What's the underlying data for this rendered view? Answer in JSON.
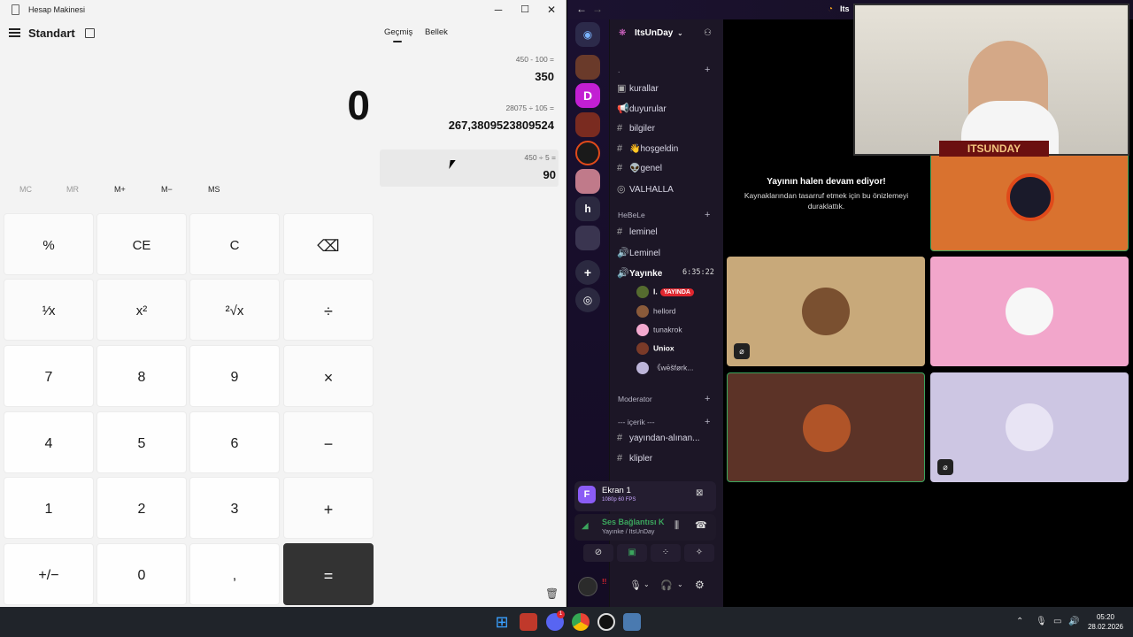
{
  "calculator": {
    "window_title": "Hesap Makinesi",
    "mode_title": "Standart",
    "display_value": "0",
    "tabs": [
      "Geçmiş",
      "Bellek"
    ],
    "memory_buttons": [
      "MC",
      "MR",
      "M+",
      "M−",
      "MS"
    ],
    "keys": [
      "%",
      "CE",
      "C",
      "⌫",
      "¹⁄x",
      "x²",
      "²√x",
      "÷",
      "7",
      "8",
      "9",
      "×",
      "4",
      "5",
      "6",
      "−",
      "1",
      "2",
      "3",
      "+",
      "+/−",
      "0",
      ",",
      "="
    ],
    "history": [
      {
        "expression": "450   -   100 =",
        "result": "350"
      },
      {
        "expression": "28075   ÷   105 =",
        "result": "267,3809523809524"
      },
      {
        "expression": "450   ÷   5 =",
        "result": "90"
      }
    ]
  },
  "discord": {
    "server_name": "ItsUnDay",
    "top_title": "Its",
    "server_icons": [
      "D",
      "h"
    ],
    "categories": [
      ".",
      "HeBeLe",
      "Moderator",
      "--- içerik ---"
    ],
    "channels_a": [
      "kurallar",
      "duyurular",
      "bilgiler",
      "👋hoşgeldin",
      "👽genel",
      "VALHALLA"
    ],
    "channels_b": [
      "leminel",
      "Leminel"
    ],
    "voice_channel": {
      "name": "Yayınke",
      "time": "6:35:22"
    },
    "voice_users": [
      "I.",
      "hellord",
      "tunakrok",
      "Uniox",
      "《wēšførk..."
    ],
    "live_badge": "YAYINDA",
    "channels_c": [
      "yayından-alınan...",
      "klipler"
    ],
    "stream_panel": {
      "title": "Ekran 1",
      "quality": "1080p 60 FPS"
    },
    "voice_panel": {
      "status": "Ses Bağlantısı K",
      "location": "Yayınke / ItsUnDay"
    },
    "user_name": "!!",
    "stream_notice": {
      "title": "Yayının halen devam ediyor!",
      "body": "Kaynaklarından tasarruf etmek için bu önizlemeyi duraklattık."
    },
    "webcam_banner": "ITSUNDAY"
  },
  "taskbar": {
    "time": "05:20",
    "date": "28.02.2026",
    "notification_badge": "1"
  },
  "colors": {
    "calc_bg": "#f3f3f3",
    "equals_key": "#333333",
    "discord_bg": "#121214",
    "tile_tan": "#c8a97a",
    "tile_pink": "#f2a6cb",
    "tile_brown": "#5c3327",
    "tile_lavender": "#cdc6e3",
    "tile_orange": "#d9722f",
    "live_red": "#e0272f"
  }
}
